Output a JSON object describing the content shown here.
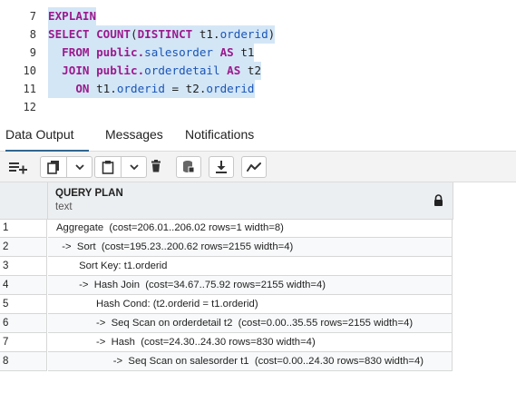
{
  "editor": {
    "lines": [
      {
        "num": "7",
        "tokens": [
          {
            "t": "EXPLAIN",
            "c": "kw"
          }
        ]
      },
      {
        "num": "8",
        "tokens": [
          {
            "t": "SELECT ",
            "c": "kw"
          },
          {
            "t": "COUNT",
            "c": "kw"
          },
          {
            "t": "(",
            "c": "plain"
          },
          {
            "t": "DISTINCT ",
            "c": "kw"
          },
          {
            "t": "t1.",
            "c": "plain"
          },
          {
            "t": "orderid",
            "c": "ident"
          },
          {
            "t": ")",
            "c": "plain"
          }
        ]
      },
      {
        "num": "9",
        "tokens": [
          {
            "t": "  FROM ",
            "c": "kw"
          },
          {
            "t": "public.",
            "c": "kw"
          },
          {
            "t": "salesorder ",
            "c": "ident"
          },
          {
            "t": "AS ",
            "c": "kw"
          },
          {
            "t": "t1",
            "c": "plain"
          }
        ]
      },
      {
        "num": "10",
        "tokens": [
          {
            "t": "  JOIN ",
            "c": "kw"
          },
          {
            "t": "public.",
            "c": "kw"
          },
          {
            "t": "orderdetail ",
            "c": "ident"
          },
          {
            "t": "AS ",
            "c": "kw"
          },
          {
            "t": "t2",
            "c": "plain"
          }
        ]
      },
      {
        "num": "11",
        "tokens": [
          {
            "t": "    ON ",
            "c": "kw"
          },
          {
            "t": "t1.",
            "c": "plain"
          },
          {
            "t": "orderid ",
            "c": "ident"
          },
          {
            "t": "= ",
            "c": "plain"
          },
          {
            "t": "t2.",
            "c": "plain"
          },
          {
            "t": "orderid",
            "c": "ident"
          }
        ]
      },
      {
        "num": "12",
        "tokens": []
      }
    ]
  },
  "tabs": {
    "data_output": "Data Output",
    "messages": "Messages",
    "notifications": "Notifications"
  },
  "toolbar": {
    "icons": [
      "add-row-icon",
      "copy-icon",
      "chevron-down-icon",
      "paste-icon",
      "chevron-down-icon",
      "delete-icon",
      "save-data-icon",
      "download-icon",
      "graph-visualiser-icon"
    ]
  },
  "grid": {
    "column": {
      "name": "QUERY PLAN",
      "type": "text"
    },
    "rows": [
      {
        "n": "1",
        "v": "Aggregate  (cost=206.01..206.02 rows=1 width=8)"
      },
      {
        "n": "2",
        "v": "  ->  Sort  (cost=195.23..200.62 rows=2155 width=4)"
      },
      {
        "n": "3",
        "v": "        Sort Key: t1.orderid"
      },
      {
        "n": "4",
        "v": "        ->  Hash Join  (cost=34.67..75.92 rows=2155 width=4)"
      },
      {
        "n": "5",
        "v": "              Hash Cond: (t2.orderid = t1.orderid)"
      },
      {
        "n": "6",
        "v": "              ->  Seq Scan on orderdetail t2  (cost=0.00..35.55 rows=2155 width=4)"
      },
      {
        "n": "7",
        "v": "              ->  Hash  (cost=24.30..24.30 rows=830 width=4)"
      },
      {
        "n": "8",
        "v": "                    ->  Seq Scan on salesorder t1  (cost=0.00..24.30 rows=830 width=4)"
      }
    ]
  },
  "colors": {
    "selection": "#d3e6f6",
    "keyword": "#9b1a8d",
    "identifier": "#1a55b6",
    "accent": "#326690"
  }
}
